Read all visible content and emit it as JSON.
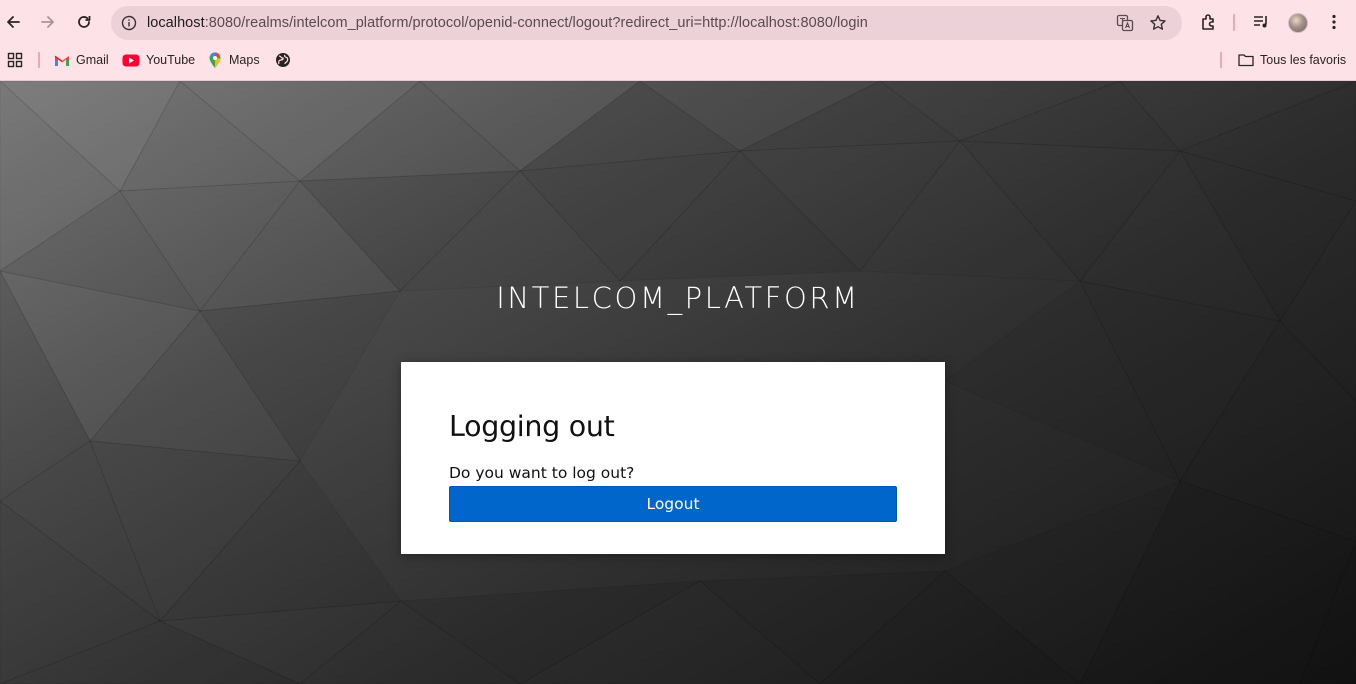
{
  "browser": {
    "url_host": "localhost",
    "url_rest": ":8080/realms/intelcom_platform/protocol/openid-connect/logout?redirect_uri=http://localhost:8080/login",
    "bookmarks": [
      {
        "label": "Gmail",
        "icon": "gmail-icon"
      },
      {
        "label": "YouTube",
        "icon": "youtube-icon"
      },
      {
        "label": "Maps",
        "icon": "maps-icon"
      },
      {
        "label": "",
        "icon": "globe-icon"
      }
    ],
    "all_bookmarks_label": "Tous les favoris",
    "colors": {
      "chrome_bg": "#fde3e8",
      "omnibox_bg": "#ecd2d8"
    }
  },
  "page": {
    "realm_name": "INTELCOM_PLATFORM",
    "card": {
      "title": "Logging out",
      "question": "Do you want to log out?",
      "logout_label": "Logout"
    },
    "colors": {
      "button": "#0066cc",
      "card_bg": "#ffffff"
    }
  }
}
